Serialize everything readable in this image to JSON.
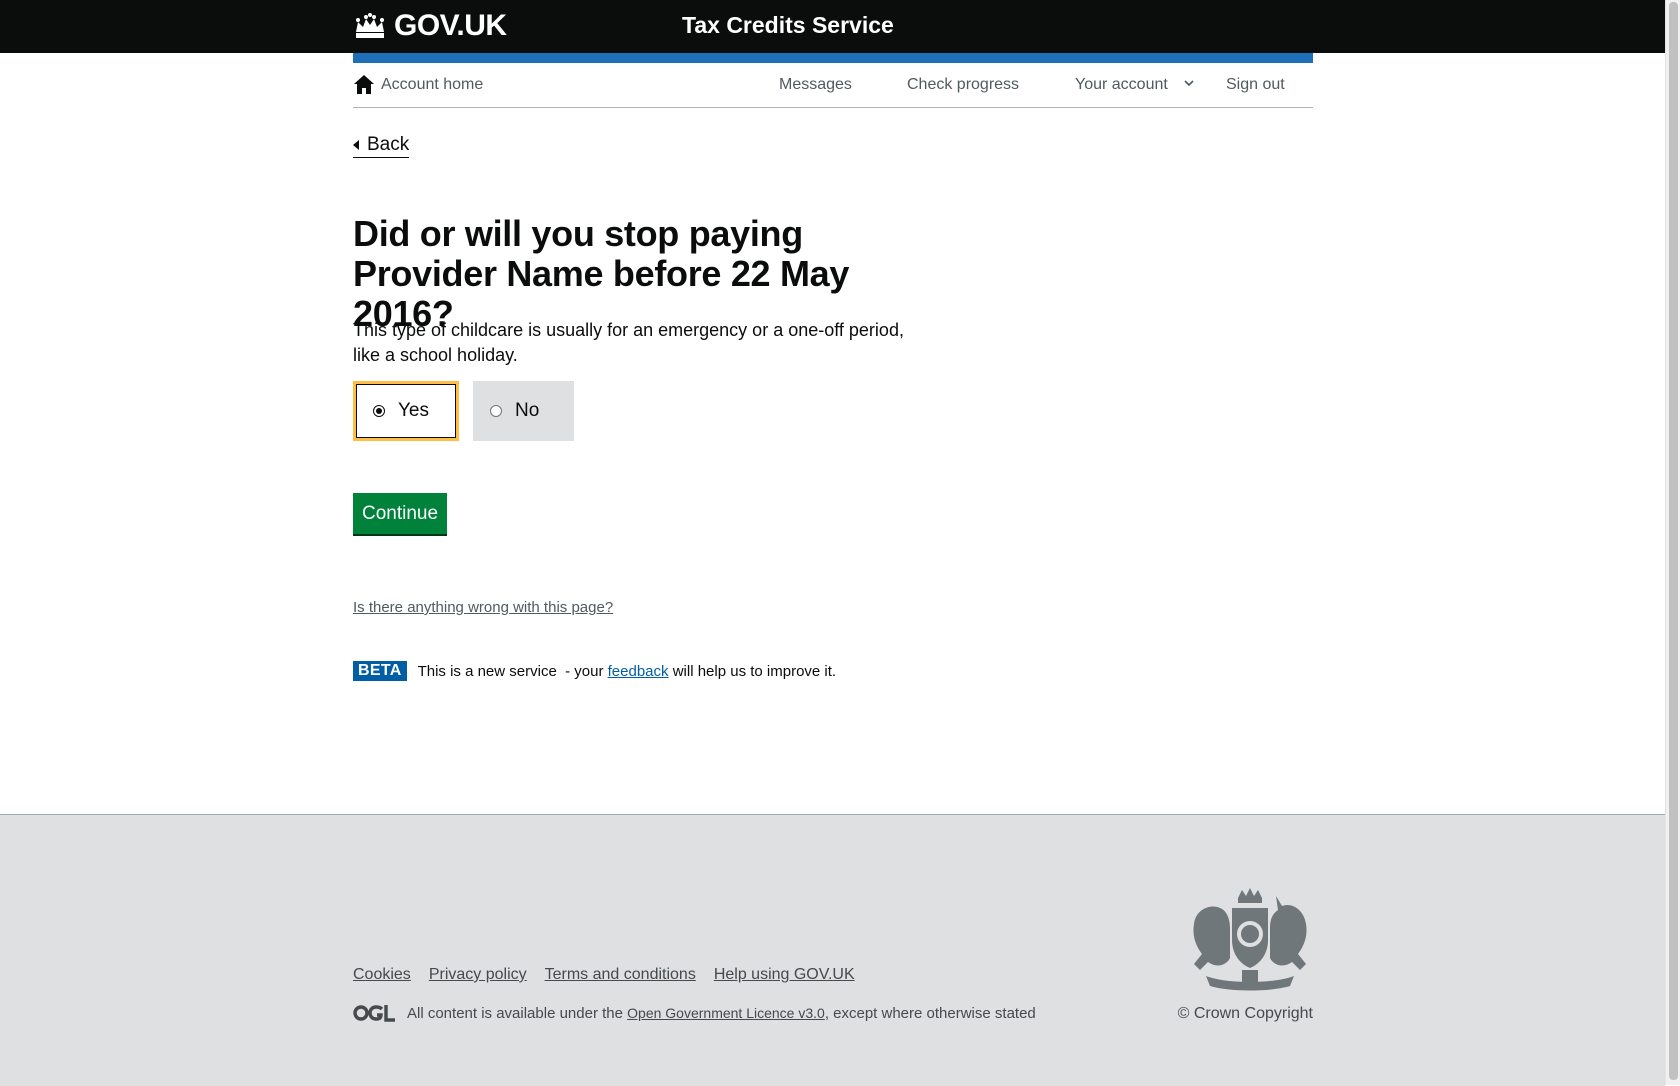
{
  "header": {
    "logo_text": "GOV.UK",
    "service_name": "Tax Credits Service"
  },
  "account_nav": {
    "home": "Account home",
    "messages": "Messages",
    "check_progress": "Check progress",
    "your_account": "Your account",
    "sign_out": "Sign out"
  },
  "back_label": "Back",
  "question": {
    "heading": "Did or will you stop paying Provider Name before 22 May 2016?",
    "hint": "This type of childcare is usually for an emergency or a one-off period, like a school holiday.",
    "options": [
      {
        "label": "Yes",
        "selected": true
      },
      {
        "label": "No",
        "selected": false
      }
    ]
  },
  "continue_label": "Continue",
  "report_link": "Is there anything wrong with this page?",
  "beta": {
    "tag": "BETA",
    "text_before": "This is a new service  - your ",
    "link": "feedback",
    "text_after": " will help us to improve it."
  },
  "footer": {
    "links": [
      "Cookies",
      "Privacy policy",
      "Terms and conditions",
      "Help using GOV.UK"
    ],
    "licence_before": "All content is available under the ",
    "licence_link": "Open Government Licence v3.0",
    "licence_after": ", except where otherwise stated",
    "copyright": "© Crown Copyright"
  },
  "colors": {
    "header_bg": "#0b0c0c",
    "accent_blue": "#1d70b8",
    "focus_yellow": "#ffbf47",
    "button_green": "#00823b",
    "footer_bg": "#dee0e2",
    "beta_blue": "#005ea5"
  }
}
